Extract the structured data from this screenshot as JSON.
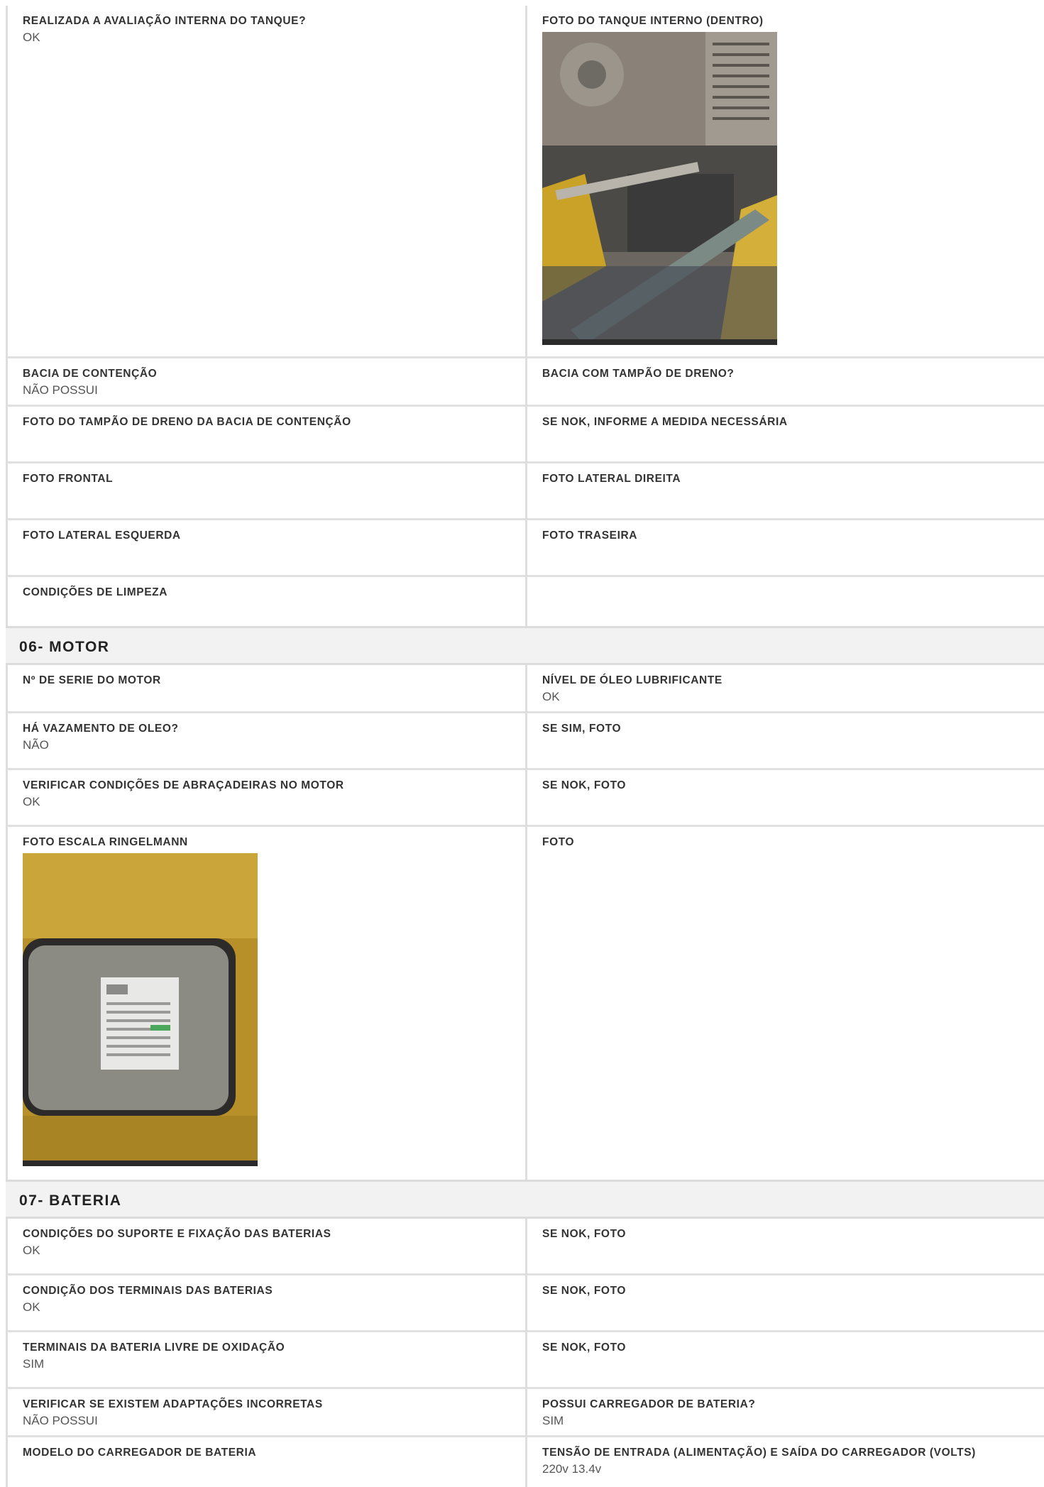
{
  "top_rows": [
    {
      "left": {
        "label": "REALIZADA A AVALIAÇÃO INTERNA DO TANQUE?",
        "value": "OK"
      },
      "right": {
        "label": "FOTO DO TANQUE INTERNO (DENTRO)",
        "value": ""
      }
    },
    {
      "left": {
        "label": "BACIA DE CONTENÇÃO",
        "value": "NÃO POSSUI"
      },
      "right": {
        "label": "BACIA COM TAMPÃO DE DRENO?",
        "value": ""
      }
    },
    {
      "left": {
        "label": "FOTO DO TAMPÃO DE DRENO DA BACIA DE CONTENÇÃO",
        "value": ""
      },
      "right": {
        "label": "SE NOK, INFORME A MEDIDA NECESSÁRIA",
        "value": ""
      }
    },
    {
      "left": {
        "label": "FOTO FRONTAL",
        "value": ""
      },
      "right": {
        "label": "FOTO LATERAL DIREITA",
        "value": ""
      }
    },
    {
      "left": {
        "label": "FOTO LATERAL ESQUERDA",
        "value": ""
      },
      "right": {
        "label": "FOTO TRASEIRA",
        "value": ""
      }
    },
    {
      "left": {
        "label": "CONDIÇÕES DE LIMPEZA",
        "value": ""
      },
      "right": {
        "label": "",
        "value": ""
      }
    }
  ],
  "section_motor": {
    "title": "06- MOTOR",
    "rows": [
      {
        "left": {
          "label": "Nº DE SERIE DO MOTOR",
          "value": ""
        },
        "right": {
          "label": "NÍVEL DE ÓLEO LUBRIFICANTE",
          "value": "OK"
        }
      },
      {
        "left": {
          "label": "HÁ VAZAMENTO DE OLEO?",
          "value": "NÃO"
        },
        "right": {
          "label": "SE SIM, FOTO",
          "value": ""
        }
      },
      {
        "left": {
          "label": "VERIFICAR CONDIÇÕES DE ABRAÇADEIRAS NO MOTOR",
          "value": "OK"
        },
        "right": {
          "label": "SE NOK, FOTO",
          "value": ""
        }
      },
      {
        "left": {
          "label": "FOTO ESCALA RINGELMANN",
          "value": ""
        },
        "right": {
          "label": "FOTO",
          "value": ""
        }
      }
    ]
  },
  "section_bateria": {
    "title": "07- BATERIA",
    "rows": [
      {
        "left": {
          "label": "CONDIÇÕES DO SUPORTE E FIXAÇÃO DAS BATERIAS",
          "value": "OK"
        },
        "right": {
          "label": "SE NOK, FOTO",
          "value": ""
        }
      },
      {
        "left": {
          "label": "CONDIÇÃO DOS TERMINAIS DAS BATERIAS",
          "value": "OK"
        },
        "right": {
          "label": "SE NOK, FOTO",
          "value": ""
        }
      },
      {
        "left": {
          "label": "TERMINAIS DA BATERIA LIVRE DE OXIDAÇÃO",
          "value": "SIM"
        },
        "right": {
          "label": "SE NOK, FOTO",
          "value": ""
        }
      },
      {
        "left": {
          "label": "VERIFICAR SE EXISTEM ADAPTAÇÕES INCORRETAS",
          "value": "NÃO POSSUI"
        },
        "right": {
          "label": "POSSUI CARREGADOR DE BATERIA?",
          "value": "SIM"
        }
      },
      {
        "left": {
          "label": "MODELO DO CARREGADOR DE BATERIA",
          "value": ""
        },
        "right": {
          "label": "TENSÃO DE ENTRADA (ALIMENTAÇÃO) E SAÍDA DO CARREGADOR (VOLTS)",
          "value": "220v 13.4v"
        }
      }
    ]
  },
  "colors": {
    "section_bg": "#f2f2f2",
    "border": "#dedede",
    "photo_yellow": "#c9a227"
  }
}
